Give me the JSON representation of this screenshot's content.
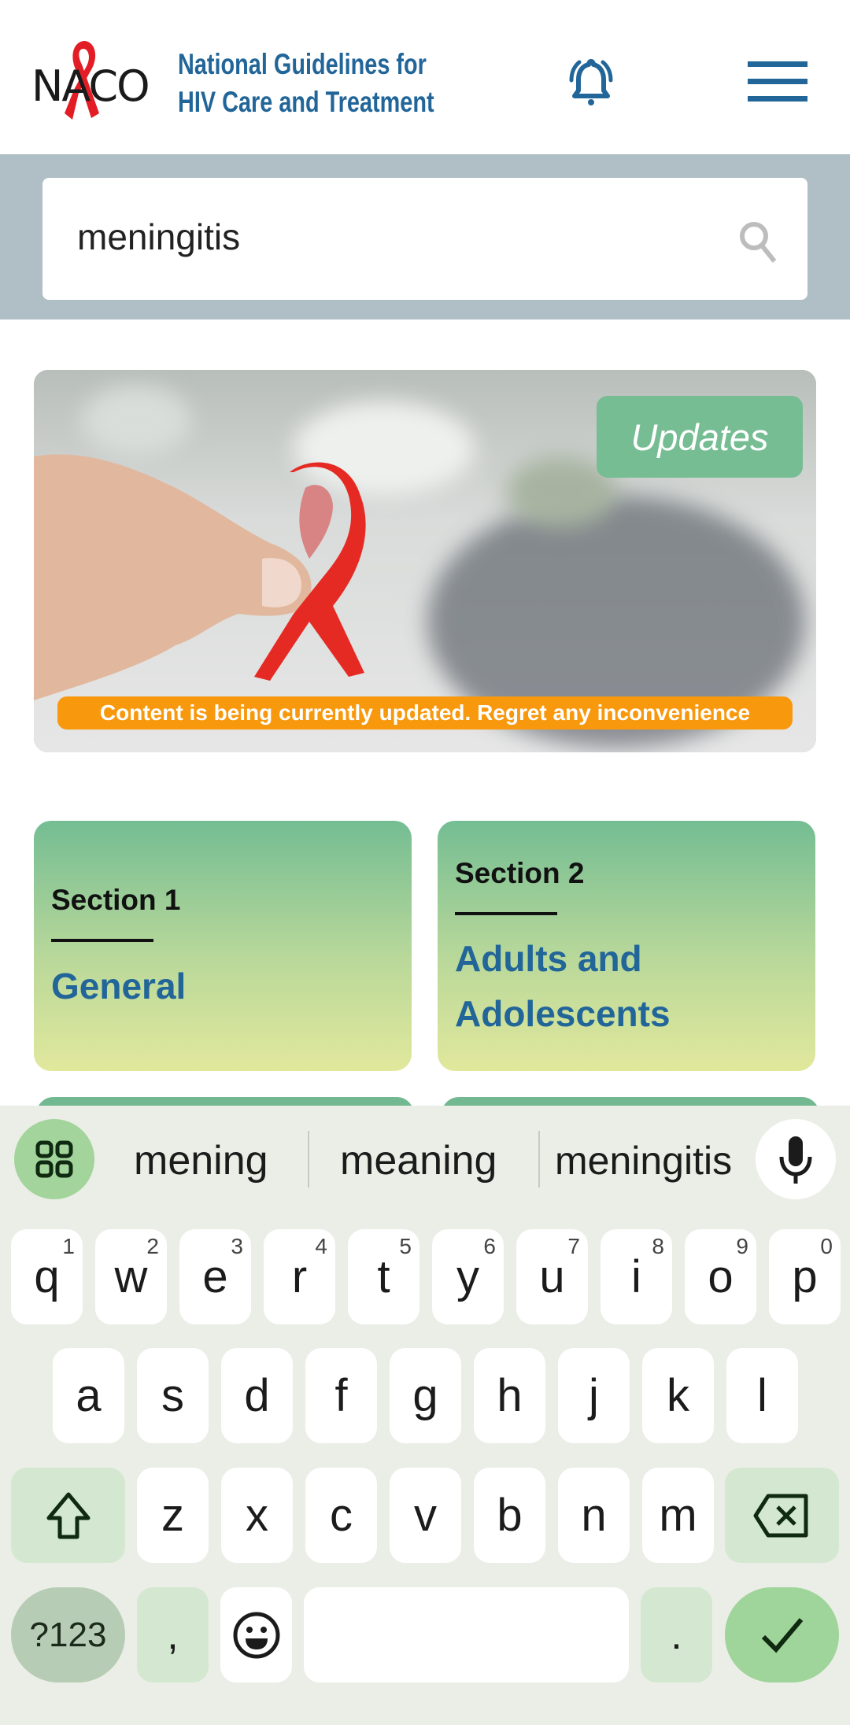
{
  "header": {
    "logo_text": "NACO",
    "title_line1": "National Guidelines for",
    "title_line2": "HIV Care and Treatment",
    "bell_icon": "bell-icon",
    "menu_icon": "hamburger-menu-icon"
  },
  "search": {
    "value": "meningitis",
    "placeholder": "",
    "icon": "search-icon"
  },
  "banner": {
    "updates_label": "Updates",
    "notice": "Content is being currently updated. Regret any inconvenience",
    "image_alt": "hand holding red ribbon"
  },
  "cards": [
    {
      "section": "Section 1",
      "title_lines": [
        "General"
      ]
    },
    {
      "section": "Section 2",
      "title_lines": [
        "Adults and",
        "Adolescents"
      ]
    }
  ],
  "keyboard": {
    "suggestions": [
      "mening",
      "meaning",
      "meningitis"
    ],
    "row1": [
      {
        "k": "q",
        "n": "1"
      },
      {
        "k": "w",
        "n": "2"
      },
      {
        "k": "e",
        "n": "3"
      },
      {
        "k": "r",
        "n": "4"
      },
      {
        "k": "t",
        "n": "5"
      },
      {
        "k": "y",
        "n": "6"
      },
      {
        "k": "u",
        "n": "7"
      },
      {
        "k": "i",
        "n": "8"
      },
      {
        "k": "o",
        "n": "9"
      },
      {
        "k": "p",
        "n": "0"
      }
    ],
    "row2": [
      "a",
      "s",
      "d",
      "f",
      "g",
      "h",
      "j",
      "k",
      "l"
    ],
    "row3": [
      "z",
      "x",
      "c",
      "v",
      "b",
      "n",
      "m"
    ],
    "symbols_label": "?123",
    "comma": ",",
    "period": ".",
    "icons": {
      "grid": "apps-grid-icon",
      "mic": "microphone-icon",
      "shift": "shift-arrow-icon",
      "backspace": "backspace-icon",
      "emoji": "emoji-icon",
      "enter": "checkmark-icon"
    }
  },
  "colors": {
    "brand_blue": "#226699",
    "updates_green": "#76bd93",
    "notice_orange": "#f7980d",
    "search_band": "#b0bfc6"
  }
}
